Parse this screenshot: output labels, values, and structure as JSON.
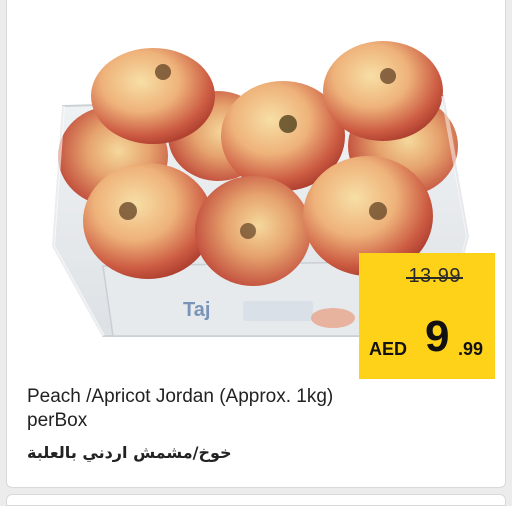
{
  "product": {
    "title_line1": "Peach /Apricot Jordan  (Approx. 1kg)",
    "title_line2": "perBox",
    "arabic_name": "خوخ/مشمش اردني بالعلبة",
    "brand_on_box": "Taj"
  },
  "price": {
    "old": "13.99",
    "currency": "AED",
    "main": "9",
    "cents": ".99"
  },
  "colors": {
    "price_tag_bg": "#ffd21a",
    "peach_red": "#c8463a",
    "peach_yellow": "#f2c27a"
  }
}
